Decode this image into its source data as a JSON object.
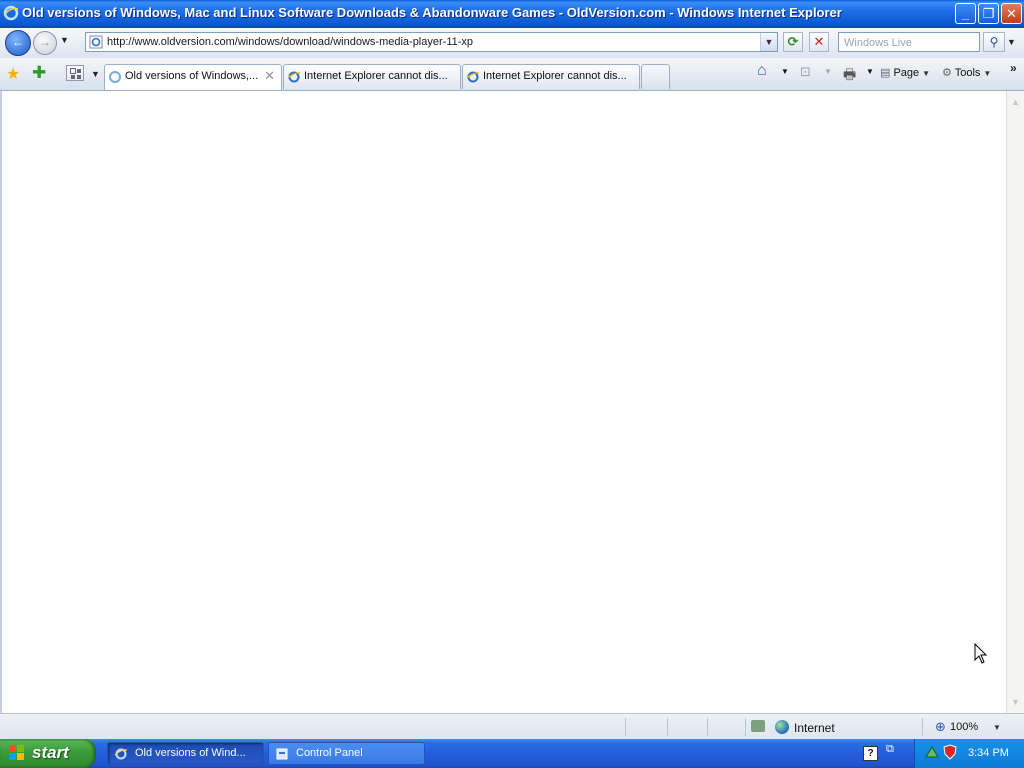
{
  "window": {
    "title": "Old versions of Windows, Mac and Linux Software Downloads & Abandonware Games - OldVersion.com - Windows Internet Explorer",
    "minimize": "_",
    "maximize": "❐",
    "close": "✕"
  },
  "navigation": {
    "address_url": "http://www.oldversion.com/windows/download/windows-media-player-11-xp",
    "search_placeholder": "Windows Live"
  },
  "tabs": [
    {
      "label": "Old versions of Windows,...",
      "active": true,
      "loading": true
    },
    {
      "label": "Internet Explorer cannot dis...",
      "active": false
    },
    {
      "label": "Internet Explorer cannot dis...",
      "active": false
    }
  ],
  "commands": {
    "page": "Page",
    "tools": "Tools"
  },
  "statusbar": {
    "zone": "Internet",
    "zoom": "100%"
  },
  "taskbar": {
    "start": "start",
    "buttons": [
      {
        "label": "Old versions of Wind...",
        "icon": "ie-icon",
        "active": true
      },
      {
        "label": "Control Panel",
        "icon": "control-panel-icon",
        "active": false
      }
    ],
    "clock": "3:34 PM"
  },
  "colors": {
    "titlebar": "#0b58d0",
    "taskbar": "#245edb",
    "start": "#3a9a3a",
    "tray": "#0c7ad8"
  }
}
